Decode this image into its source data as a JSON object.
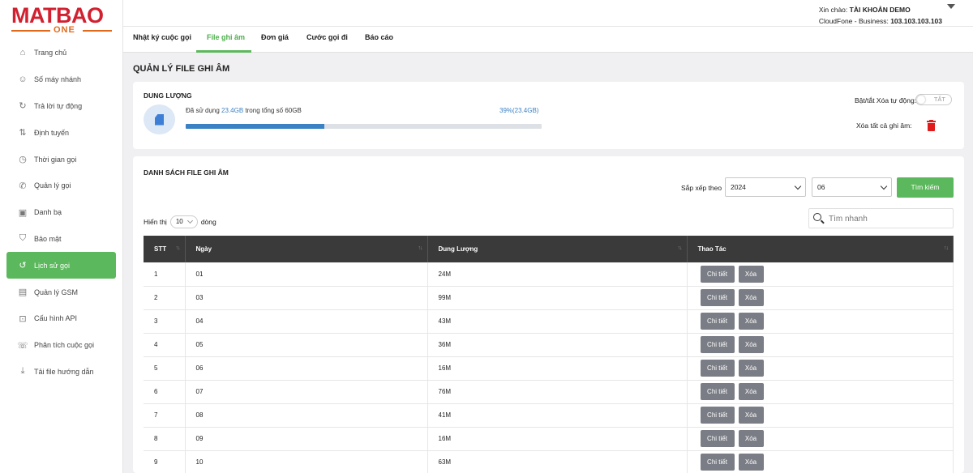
{
  "brand": {
    "name": "MATBAO",
    "sub": "ONE"
  },
  "sidebar": {
    "items": [
      {
        "label": "Trang chủ",
        "icon": "home-icon",
        "glyph": "⌂"
      },
      {
        "label": "Số máy nhánh",
        "icon": "extension-users-icon",
        "glyph": "☺"
      },
      {
        "label": "Trả lời tự động",
        "icon": "auto-reply-icon",
        "glyph": "↻"
      },
      {
        "label": "Định tuyến",
        "icon": "routing-icon",
        "glyph": "⇅"
      },
      {
        "label": "Thời gian gọi",
        "icon": "clock-icon",
        "glyph": "◷"
      },
      {
        "label": "Quản lý gọi",
        "icon": "phone-icon",
        "glyph": "✆"
      },
      {
        "label": "Danh bạ",
        "icon": "contacts-icon",
        "glyph": "▣"
      },
      {
        "label": "Bảo mật",
        "icon": "shield-icon",
        "glyph": "⛉"
      },
      {
        "label": "Lịch sử gọi",
        "icon": "history-icon",
        "glyph": "↺",
        "active": true
      },
      {
        "label": "Quản lý GSM",
        "icon": "sim-icon",
        "glyph": "▤"
      },
      {
        "label": "Cấu hình API",
        "icon": "api-icon",
        "glyph": "⊡"
      },
      {
        "label": "Phân tích cuộc gọi",
        "icon": "analytics-icon",
        "glyph": "☏"
      },
      {
        "label": "Tải file hướng dẫn",
        "icon": "download-icon",
        "glyph": "⤓"
      }
    ]
  },
  "header": {
    "greeting_prefix": "Xin chào: ",
    "account": "TÀI KHOẢN DEMO",
    "plan_prefix": "CloudFone - Business: ",
    "number": "103.103.103.103"
  },
  "tabs": [
    {
      "label": "Nhật ký cuộc gọi"
    },
    {
      "label": "File ghi âm",
      "active": true
    },
    {
      "label": "Đơn giá"
    },
    {
      "label": "Cước gọi đi"
    },
    {
      "label": "Báo cáo"
    }
  ],
  "page_title": "QUẢN LÝ FILE GHI ÂM",
  "storage": {
    "heading": "DUNG LƯỢNG",
    "used_prefix": "Đã sử dụng ",
    "used_value": "23.4GB",
    "used_suffix": " trong tổng số 60GB",
    "percent_label": "39%(23.4GB)",
    "fraction_used": 0.39,
    "auto_delete_label": "Bật/tắt Xóa tự động:",
    "toggle_text": "TẮT",
    "delete_all_label": "Xóa tất cả ghi âm:",
    "icon": "sd-card-icon",
    "trash_icon": "trash-icon"
  },
  "list": {
    "heading": "DANH SÁCH FILE GHI ÂM",
    "sort_label": "Sắp xếp theo",
    "year": "2024",
    "month": "06",
    "search_button": "Tìm kiếm",
    "show_prefix": "Hiển thị",
    "page_size": "10",
    "show_suffix": "dòng",
    "quick_search_placeholder": "Tìm nhanh",
    "columns": [
      "STT",
      "Ngày",
      "Dung Lượng",
      "Thao Tác"
    ],
    "detail_label": "Chi tiết",
    "delete_label": "Xóa",
    "rows": [
      {
        "stt": "1",
        "day": "01",
        "size": "24M"
      },
      {
        "stt": "2",
        "day": "03",
        "size": "99M"
      },
      {
        "stt": "3",
        "day": "04",
        "size": "43M"
      },
      {
        "stt": "4",
        "day": "05",
        "size": "36M"
      },
      {
        "stt": "5",
        "day": "06",
        "size": "16M"
      },
      {
        "stt": "6",
        "day": "07",
        "size": "76M"
      },
      {
        "stt": "7",
        "day": "08",
        "size": "41M"
      },
      {
        "stt": "8",
        "day": "09",
        "size": "16M"
      },
      {
        "stt": "9",
        "day": "10",
        "size": "63M"
      }
    ]
  },
  "colors": {
    "accent_green": "#5cb85c",
    "link_blue": "#3b82c4",
    "brand_red": "#d1202f",
    "brand_orange": "#e06a1b",
    "table_header": "#3a3a3a"
  }
}
